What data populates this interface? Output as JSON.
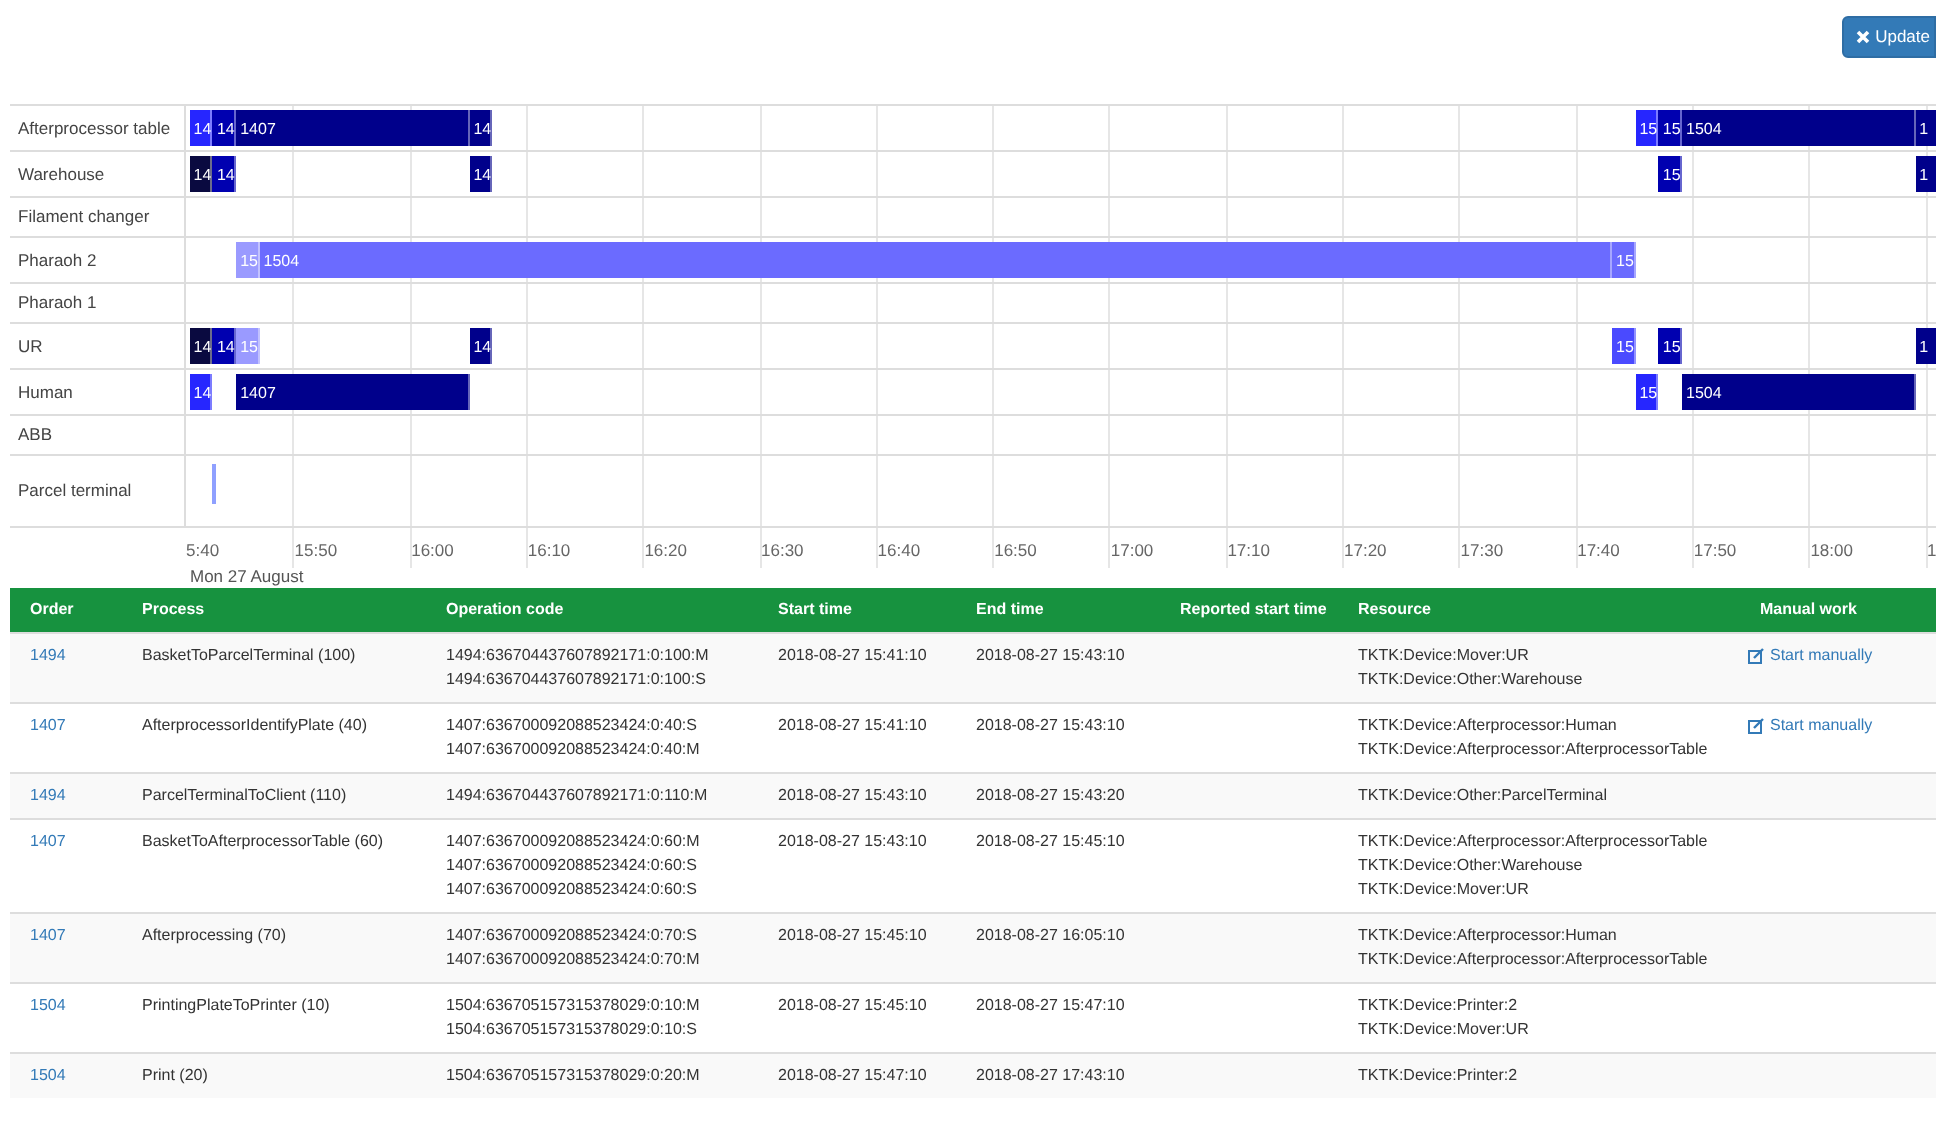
{
  "toolbar": {
    "update_button": "Update"
  },
  "gantt": {
    "rows": [
      {
        "label": "Afterprocessor table",
        "bars": [
          {
            "kind": "task",
            "label": "14",
            "color": "#2626ff"
          },
          {
            "kind": "task",
            "label": "14",
            "color": "#0000b0"
          },
          {
            "kind": "task",
            "label": "1407",
            "color": "#00008b"
          },
          {
            "kind": "task",
            "label": "14",
            "color": "#00008b"
          },
          {
            "kind": "task",
            "label": "15",
            "color": "#2626ff"
          },
          {
            "kind": "task",
            "label": "15",
            "color": "#0000b0"
          },
          {
            "kind": "task",
            "label": "1504",
            "color": "#00008b"
          },
          {
            "kind": "task",
            "label": "1",
            "color": "#00008b"
          }
        ]
      },
      {
        "label": "Warehouse",
        "bars": [
          {
            "kind": "task",
            "label": "14",
            "color": "#0a0a40"
          },
          {
            "kind": "task",
            "label": "14",
            "color": "#0000b0"
          },
          {
            "kind": "task",
            "label": "14",
            "color": "#00008b"
          },
          {
            "kind": "task",
            "label": "15",
            "color": "#0000b0"
          },
          {
            "kind": "task",
            "label": "1",
            "color": "#00008b"
          }
        ]
      },
      {
        "label": "Filament changer",
        "bars": []
      },
      {
        "label": "Pharaoh 2",
        "bars": [
          {
            "kind": "task",
            "label": "15",
            "color": "#9a9aff"
          },
          {
            "kind": "task",
            "label": "1504",
            "color": "#6b6bff"
          },
          {
            "kind": "task",
            "label": "15",
            "color": "#6b6bff"
          }
        ]
      },
      {
        "label": "Pharaoh 1",
        "bars": []
      },
      {
        "label": "UR",
        "bars": [
          {
            "kind": "task",
            "label": "14",
            "color": "#0a0a40"
          },
          {
            "kind": "task",
            "label": "14",
            "color": "#0000b0"
          },
          {
            "kind": "task",
            "label": "15",
            "color": "#9a9aff"
          },
          {
            "kind": "task",
            "label": "14",
            "color": "#00008b"
          },
          {
            "kind": "task",
            "label": "15",
            "color": "#4a4aff"
          },
          {
            "kind": "task",
            "label": "15",
            "color": "#0000b0"
          },
          {
            "kind": "task",
            "label": "1",
            "color": "#00008b"
          }
        ]
      },
      {
        "label": "Human",
        "bars": [
          {
            "kind": "task",
            "label": "14",
            "color": "#2626ff"
          },
          {
            "kind": "task",
            "label": "1407",
            "color": "#00008b"
          },
          {
            "kind": "task",
            "label": "15",
            "color": "#2626ff"
          },
          {
            "kind": "task",
            "label": "1504",
            "color": "#00008b"
          }
        ]
      },
      {
        "label": "ABB",
        "bars": []
      },
      {
        "label": "Parcel terminal",
        "bars": [
          {
            "kind": "marker",
            "color": "#8fa0ff"
          }
        ]
      }
    ],
    "ticks": [
      "5:40",
      "15:50",
      "16:00",
      "16:10",
      "16:20",
      "16:30",
      "16:40",
      "16:50",
      "17:00",
      "17:10",
      "17:20",
      "17:30",
      "17:40",
      "17:50",
      "18:00",
      "1"
    ],
    "date": "Mon 27 August"
  },
  "table": {
    "columns": [
      "Order",
      "Process",
      "Operation code",
      "Start time",
      "End time",
      "Reported start time",
      "Resource",
      "Manual work"
    ],
    "rows": [
      {
        "order": "1494",
        "process": "BasketToParcelTerminal (100)",
        "operation_codes": [
          "1494:636704437607892171:0:100:M",
          "1494:636704437607892171:0:100:S"
        ],
        "start_time": "2018-08-27 15:41:10",
        "end_time": "2018-08-27 15:43:10",
        "resources": [
          "TKTK:Device:Mover:UR",
          "TKTK:Device:Other:Warehouse"
        ],
        "manual_work": "Start manually"
      },
      {
        "order": "1407",
        "process": "AfterprocessorIdentifyPlate (40)",
        "operation_codes": [
          "1407:636700092088523424:0:40:S",
          "1407:636700092088523424:0:40:M"
        ],
        "start_time": "2018-08-27 15:41:10",
        "end_time": "2018-08-27 15:43:10",
        "resources": [
          "TKTK:Device:Afterprocessor:Human",
          "TKTK:Device:Afterprocessor:AfterprocessorTable"
        ],
        "manual_work": "Start manually"
      },
      {
        "order": "1494",
        "process": "ParcelTerminalToClient (110)",
        "operation_codes": [
          "1494:636704437607892171:0:110:M"
        ],
        "start_time": "2018-08-27 15:43:10",
        "end_time": "2018-08-27 15:43:20",
        "resources": [
          "TKTK:Device:Other:ParcelTerminal"
        ]
      },
      {
        "order": "1407",
        "process": "BasketToAfterprocessorTable (60)",
        "operation_codes": [
          "1407:636700092088523424:0:60:M",
          "1407:636700092088523424:0:60:S",
          "1407:636700092088523424:0:60:S"
        ],
        "start_time": "2018-08-27 15:43:10",
        "end_time": "2018-08-27 15:45:10",
        "resources": [
          "TKTK:Device:Afterprocessor:AfterprocessorTable",
          "TKTK:Device:Other:Warehouse",
          "TKTK:Device:Mover:UR"
        ]
      },
      {
        "order": "1407",
        "process": "Afterprocessing (70)",
        "operation_codes": [
          "1407:636700092088523424:0:70:S",
          "1407:636700092088523424:0:70:M"
        ],
        "start_time": "2018-08-27 15:45:10",
        "end_time": "2018-08-27 16:05:10",
        "resources": [
          "TKTK:Device:Afterprocessor:Human",
          "TKTK:Device:Afterprocessor:AfterprocessorTable"
        ]
      },
      {
        "order": "1504",
        "process": "PrintingPlateToPrinter (10)",
        "operation_codes": [
          "1504:636705157315378029:0:10:M",
          "1504:636705157315378029:0:10:S"
        ],
        "start_time": "2018-08-27 15:45:10",
        "end_time": "2018-08-27 15:47:10",
        "resources": [
          "TKTK:Device:Printer:2",
          "TKTK:Device:Mover:UR"
        ]
      },
      {
        "order": "1504",
        "process": "Print (20)",
        "operation_codes": [
          "1504:636705157315378029:0:20:M"
        ],
        "start_time": "2018-08-27 15:47:10",
        "end_time": "2018-08-27 17:43:10",
        "resources": [
          "TKTK:Device:Printer:2"
        ]
      }
    ]
  }
}
